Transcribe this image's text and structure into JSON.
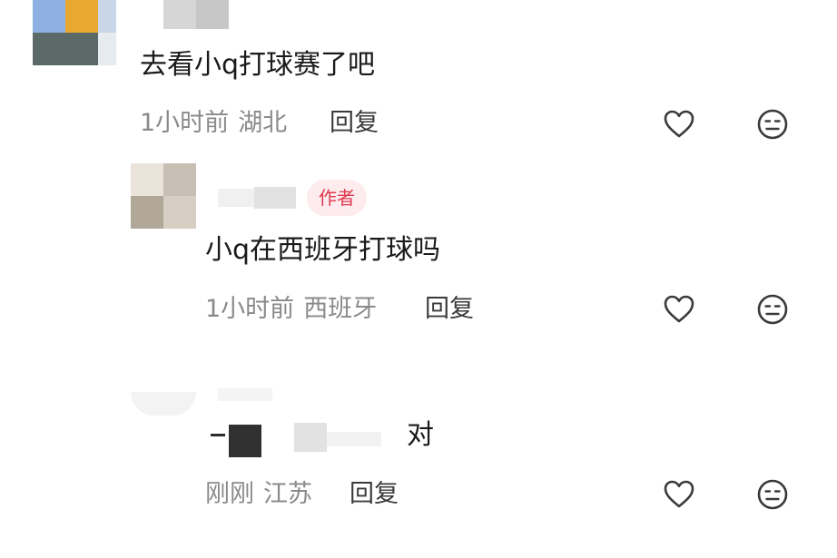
{
  "comments": [
    {
      "text": "去看小q打球赛了吧",
      "time": "1小时前",
      "location": "湖北",
      "reply_label": "回复"
    },
    {
      "author_badge": "作者",
      "text": "小q在西班牙打球吗",
      "time": "1小时前",
      "location": "西班牙",
      "reply_label": "回复"
    },
    {
      "text_suffix": "对",
      "time": "刚刚",
      "location": "江苏",
      "reply_label": "回复"
    }
  ],
  "icons": {
    "like": "heart-outline-icon",
    "dislike": "meh-face-icon"
  },
  "colors": {
    "badge_bg": "#fdebee",
    "badge_text": "#e0384d",
    "meta_text": "#8a8a8a"
  }
}
